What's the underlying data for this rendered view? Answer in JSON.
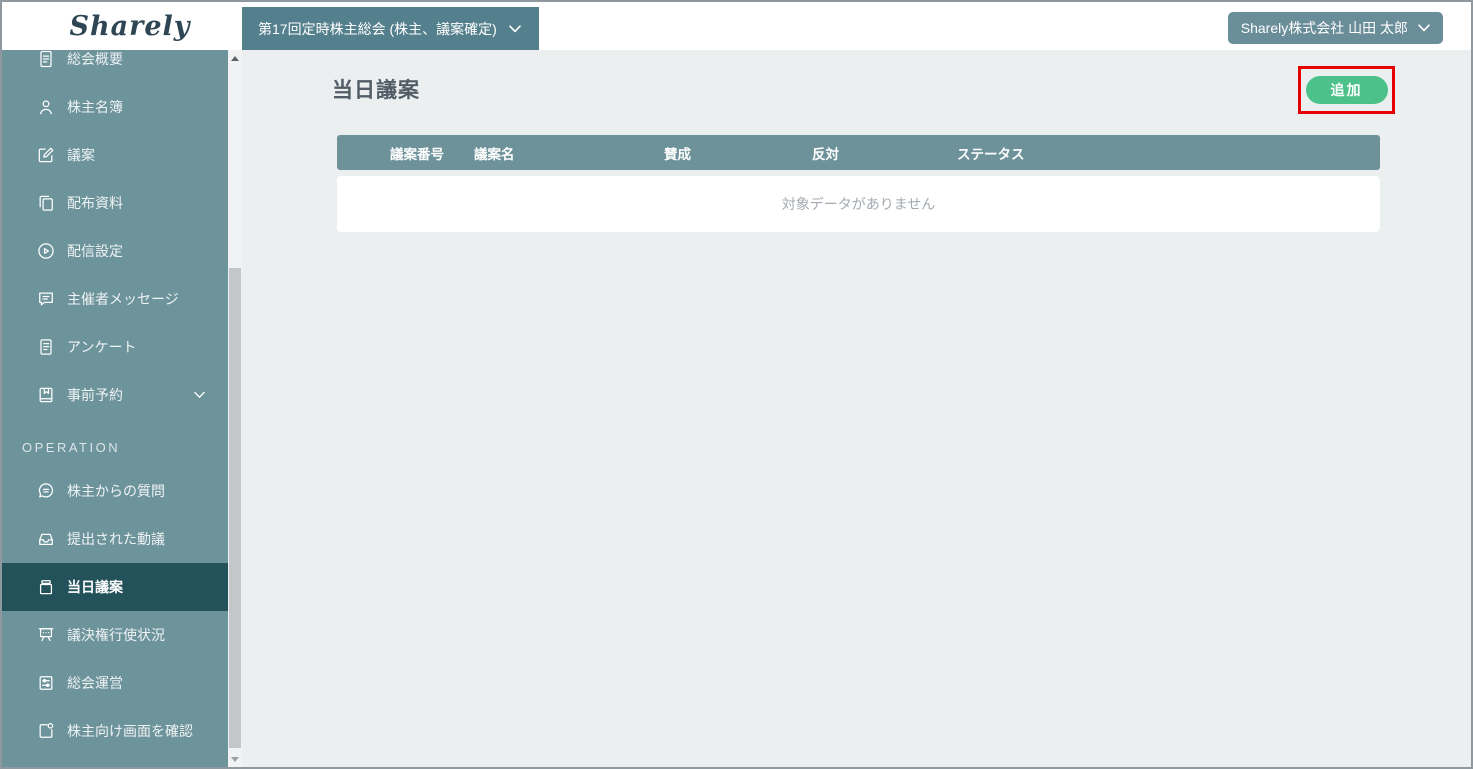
{
  "brand": {
    "logo_text": "Sharely"
  },
  "topbar": {
    "meeting_selector": {
      "label": "第17回定時株主総会 (株主、議案確定)"
    },
    "user_menu": {
      "label": "Sharely株式会社 山田 太郎"
    }
  },
  "sidebar": {
    "section_label": "OPERATION",
    "active_item": "当日議案",
    "items": [
      {
        "label": "総会概要",
        "icon": "file-text-icon"
      },
      {
        "label": "株主名簿",
        "icon": "user-icon"
      },
      {
        "label": "議案",
        "icon": "edit-icon"
      },
      {
        "label": "配布資料",
        "icon": "copy-icon"
      },
      {
        "label": "配信設定",
        "icon": "play-circle-icon"
      },
      {
        "label": "主催者メッセージ",
        "icon": "message-square-icon"
      },
      {
        "label": "アンケート",
        "icon": "survey-icon"
      },
      {
        "label": "事前予約",
        "icon": "bookmark-icon"
      },
      {
        "label": "株主からの質問",
        "icon": "question-bubble-icon"
      },
      {
        "label": "提出された動議",
        "icon": "inbox-icon"
      },
      {
        "label": "当日議案",
        "icon": "archive-icon"
      },
      {
        "label": "議決権行使状況",
        "icon": "presentation-icon"
      },
      {
        "label": "総会運営",
        "icon": "sliders-icon"
      },
      {
        "label": "株主向け画面を確認",
        "icon": "external-screen-icon"
      }
    ]
  },
  "main": {
    "page_title": "当日議案",
    "add_button_label": "追加",
    "table": {
      "columns": [
        "議案番号",
        "議案名",
        "賛成",
        "反対",
        "ステータス"
      ],
      "rows": [],
      "empty_message": "対象データがありません"
    }
  },
  "colors": {
    "sidebar": "#6d939b",
    "sidebar_active": "#24525a",
    "meeting_selector": "#54808d",
    "user_chip": "#6a8e99",
    "table_header": "#6e929a",
    "accent_green": "#4cc28a",
    "annotation_red": "#e60000",
    "content_bg": "#eceff0"
  }
}
